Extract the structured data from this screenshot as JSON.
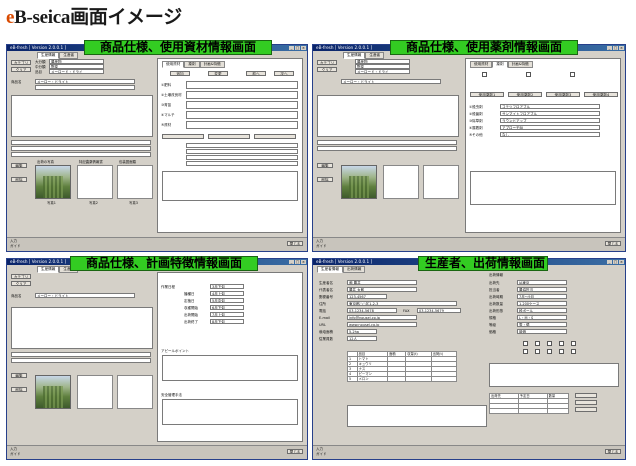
{
  "page_title": {
    "prefix": "e",
    "rest": "B-seica画面イメージ"
  },
  "colors": {
    "banner": "#33cc22",
    "titlebar": "#0a246a",
    "window_face": "#d4d0c8"
  },
  "banners": {
    "product_materials": "商品仕様、使用資材情報画面",
    "product_chemicals": "商品仕様、使用薬剤情報画面",
    "product_plan": "商品仕様、計画特徴情報画面",
    "producer_shipping": "生産者、出荷情報画面"
  },
  "window_title": "eB-fresh [ Version 2.0.0.1 ]",
  "window1": {
    "tabs": [
      "生産情報",
      "生産者"
    ],
    "buttons": {
      "category": "カテゴリ",
      "clear": "クリア",
      "edit": "編集",
      "delete": "削除"
    },
    "class_labels": [
      "大分類",
      "中分類",
      "品目"
    ],
    "class_values": [
      "農産物",
      "野菜",
      "メーロード・ドライ"
    ],
    "product_name_label": "商品名",
    "product_name_value": "メーロー・ドライト",
    "photo_captions": [
      "出荷の写真",
      "特記農薬情報書",
      "包装図面類"
    ],
    "photo_numbers": [
      "写真1",
      "写真2",
      "写真3"
    ],
    "right_tabs": [
      "使用資材",
      "薬剤",
      "計画&特徴"
    ],
    "right_buttons": [
      "追加",
      "変更",
      "削除",
      "前へ",
      "次へ"
    ],
    "materials_rows": [
      "①肥料",
      "②土壌改良材",
      "③育苗",
      "④マルチ",
      "⑤資材"
    ],
    "status_labels": [
      "入力",
      "ガイド"
    ],
    "close_label": "閉じる"
  },
  "window2": {
    "tabs": [
      "生産情報",
      "生産者"
    ],
    "right_tabs": [
      "使用資材",
      "薬剤",
      "計画&特徴"
    ],
    "chem_rows": [
      "①殺虫剤",
      "②殺菌剤",
      "③除草剤",
      "④展着剤",
      "⑤その他"
    ],
    "chem_values": [
      "コテツフロアブル",
      "サンマイトフロアブル",
      "ラウンドアップ",
      "アプローチBI",
      "なし"
    ],
    "buttons": [
      "使用薬剤1",
      "使用薬剤2",
      "使用薬剤3",
      "使用薬剤4"
    ],
    "close_label": "閉じる"
  },
  "window3": {
    "tabs": [
      "生産情報",
      "生産者"
    ],
    "plan_labels": [
      "作業日程",
      "播種日",
      "定植日",
      "収穫開始",
      "出荷開始",
      "出荷終了"
    ],
    "plan_values": [
      "3月下旬",
      "4月上旬",
      "5月中旬",
      "6月下旬",
      "7月上旬",
      "8月下旬"
    ],
    "appeal_label": "アピールポイント",
    "safety_label": "安全管理手法",
    "close_label": "閉じる"
  },
  "window4": {
    "tabs": [
      "生産者情報",
      "出荷情報"
    ],
    "left_labels": [
      "生産者名",
      "代表者名",
      "郵便番号",
      "住所",
      "電話",
      "FAX",
      "E-mail",
      "URL",
      "栽培面積",
      "従業員数"
    ],
    "left_values": [
      "㈱ 農井",
      "農井 太郎",
      "123-4567",
      "東京都○○区1-2-3",
      "03-1234-5678",
      "03-1234-5679",
      "info@nousei.co.jp",
      "www.nousei.co.jp",
      "5.2ha",
      "12人"
    ],
    "table_headers": [
      "品目",
      "面積",
      "収量(t)",
      "出荷(t)"
    ],
    "table_rows": [
      [
        "1",
        "トマト"
      ],
      [
        "2",
        "キュウリ"
      ],
      [
        "3",
        "ナス"
      ],
      [
        "4",
        "ピーマン"
      ],
      [
        "5",
        "メロン"
      ]
    ],
    "right_labels": [
      "出荷情報",
      "出荷先",
      "担当者",
      "出荷時期",
      "出荷数量",
      "出荷形態",
      "規格",
      "等級",
      "価格"
    ],
    "right_values": [
      "JA東京",
      "農協担当",
      "7月～9月",
      "1,200ケース",
      "段ボール",
      "L・M・S",
      "秀・優",
      "時価"
    ],
    "bottom_table_headers": [
      "出荷先",
      "予定日",
      "数量"
    ],
    "close_label": "閉じる"
  }
}
